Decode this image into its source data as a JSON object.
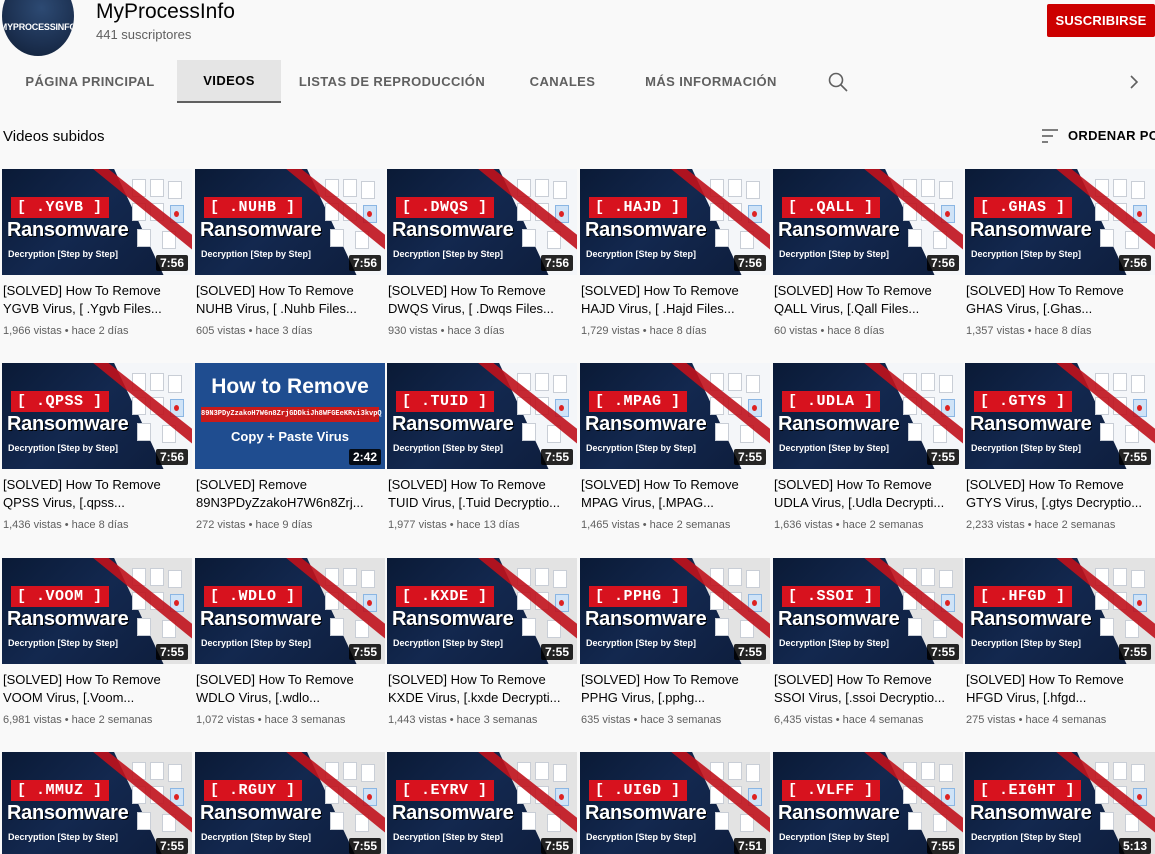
{
  "channel": {
    "name": "MyProcessInfo",
    "avatar_text": "MYPROCESSINFO",
    "subscribers": "441 suscriptores",
    "subscribe_label": "SUSCRIBIRSE"
  },
  "tabs": [
    {
      "label": "PÁGINA PRINCIPAL"
    },
    {
      "label": "VIDEOS"
    },
    {
      "label": "LISTAS DE REPRODUCCIÓN"
    },
    {
      "label": "CANALES"
    },
    {
      "label": "MÁS INFORMACIÓN"
    }
  ],
  "section": {
    "title": "Videos subidos",
    "sort_label": "ORDENAR POR"
  },
  "thumb_text": {
    "ransomware": "Ransomware",
    "decryption": "Decryption [Step by Step]"
  },
  "videos": [
    {
      "tag": "[ .YGVB ]",
      "duration": "7:56",
      "title1": "[SOLVED] How To Remove",
      "title2": "YGVB Virus, [ .Ygvb Files...",
      "meta": "1,966 vistas • hace 2 días",
      "style": "dark"
    },
    {
      "tag": "[ .NUHB ]",
      "duration": "7:56",
      "title1": "[SOLVED] How To Remove",
      "title2": "NUHB Virus, [ .Nuhb Files...",
      "meta": "605 vistas • hace 3 días",
      "style": "dark"
    },
    {
      "tag": "[ .DWQS ]",
      "duration": "7:56",
      "title1": "[SOLVED] How To Remove",
      "title2": "DWQS Virus, [ .Dwqs Files...",
      "meta": "930 vistas • hace 3 días",
      "style": "dark"
    },
    {
      "tag": "[ .HAJD ]",
      "duration": "7:56",
      "title1": "[SOLVED] How To Remove",
      "title2": "HAJD Virus, [ .Hajd Files...",
      "meta": "1,729 vistas • hace 8 días",
      "style": "dark"
    },
    {
      "tag": "[ .QALL ]",
      "duration": "7:56",
      "title1": "[SOLVED] How To Remove",
      "title2": "QALL Virus, [.Qall Files...",
      "meta": "60 vistas • hace 8 días",
      "style": "dark"
    },
    {
      "tag": "[ .GHAS ]",
      "duration": "7:56",
      "title1": "[SOLVED] How To Remove",
      "title2": "GHAS Virus, [.Ghas...",
      "meta": "1,357 vistas • hace 8 días",
      "style": "dark"
    },
    {
      "tag": "[ .QPSS ]",
      "duration": "7:56",
      "title1": "[SOLVED] How To Remove",
      "title2": "QPSS Virus, [.qpss...",
      "meta": "1,436 vistas • hace 8 días",
      "style": "dark"
    },
    {
      "tag": "",
      "duration": "2:42",
      "title1": "[SOLVED] Remove",
      "title2": "89N3PDyZzakoH7W6n8Zrj...",
      "meta": "272 vistas • hace 9 días",
      "style": "blue",
      "how": "How to Remove",
      "hash": "89N3PDyZzakoH7W6n8ZrjGDDkiJh8WFGEeKRvi3kvpQ",
      "cpv": "Copy + Paste Virus"
    },
    {
      "tag": "[ .TUID ]",
      "duration": "7:55",
      "title1": "[SOLVED] How To Remove",
      "title2": "TUID Virus, [.Tuid Decryptio...",
      "meta": "1,977 vistas • hace 13 días",
      "style": "dark"
    },
    {
      "tag": "[ .MPAG ]",
      "duration": "7:55",
      "title1": "[SOLVED] How To Remove",
      "title2": "MPAG Virus, [.MPAG...",
      "meta": "1,465 vistas • hace 2 semanas",
      "style": "dark"
    },
    {
      "tag": "[ .UDLA ]",
      "duration": "7:55",
      "title1": "[SOLVED] How To Remove",
      "title2": "UDLA Virus, [.Udla Decrypti...",
      "meta": "1,636 vistas • hace 2 semanas",
      "style": "dark"
    },
    {
      "tag": "[ .GTYS ]",
      "duration": "7:55",
      "title1": "[SOLVED] How To Remove",
      "title2": "GTYS Virus, [.gtys Decryptio...",
      "meta": "2,233 vistas • hace 2 semanas",
      "style": "dark"
    },
    {
      "tag": "[ .VOOM ]",
      "duration": "7:55",
      "title1": "[SOLVED] How To Remove",
      "title2": "VOOM Virus, [.Voom...",
      "meta": "6,981 vistas • hace 2 semanas",
      "style": "gray"
    },
    {
      "tag": "[ .WDLO ]",
      "duration": "7:55",
      "title1": "[SOLVED] How To Remove",
      "title2": "WDLO Virus, [.wdlo...",
      "meta": "1,072 vistas • hace 3 semanas",
      "style": "gray"
    },
    {
      "tag": "[ .KXDE ]",
      "duration": "7:55",
      "title1": "[SOLVED] How To Remove",
      "title2": "KXDE Virus, [.kxde Decrypti...",
      "meta": "1,443 vistas • hace 3 semanas",
      "style": "gray"
    },
    {
      "tag": "[ .PPHG ]",
      "duration": "7:55",
      "title1": "[SOLVED] How To Remove",
      "title2": "PPHG Virus, [.pphg...",
      "meta": "635 vistas • hace 3 semanas",
      "style": "gray"
    },
    {
      "tag": "[ .SSOI ]",
      "duration": "7:55",
      "title1": "[SOLVED] How To Remove",
      "title2": "SSOI Virus, [.ssoi Decryptio...",
      "meta": "6,435 vistas • hace 4 semanas",
      "style": "gray"
    },
    {
      "tag": "[ .HFGD ]",
      "duration": "7:55",
      "title1": "[SOLVED] How To Remove",
      "title2": "HFGD Virus, [.hfgd...",
      "meta": "275 vistas • hace 4 semanas",
      "style": "gray"
    },
    {
      "tag": "[ .MMUZ ]",
      "duration": "7:55",
      "style": "gray"
    },
    {
      "tag": "[ .RGUY ]",
      "duration": "7:55",
      "style": "gray"
    },
    {
      "tag": "[ .EYRV ]",
      "duration": "7:55",
      "style": "gray"
    },
    {
      "tag": "[ .UIGD ]",
      "duration": "7:51",
      "style": "gray"
    },
    {
      "tag": "[ .VLFF ]",
      "duration": "7:55",
      "style": "gray"
    },
    {
      "tag": "[ .EIGHT ]",
      "duration": "5:13",
      "style": "gray"
    }
  ],
  "colors": {
    "accent": "#cc0000",
    "tag_red": "#d7121e",
    "thumb_dark": "#0d1e3d"
  }
}
